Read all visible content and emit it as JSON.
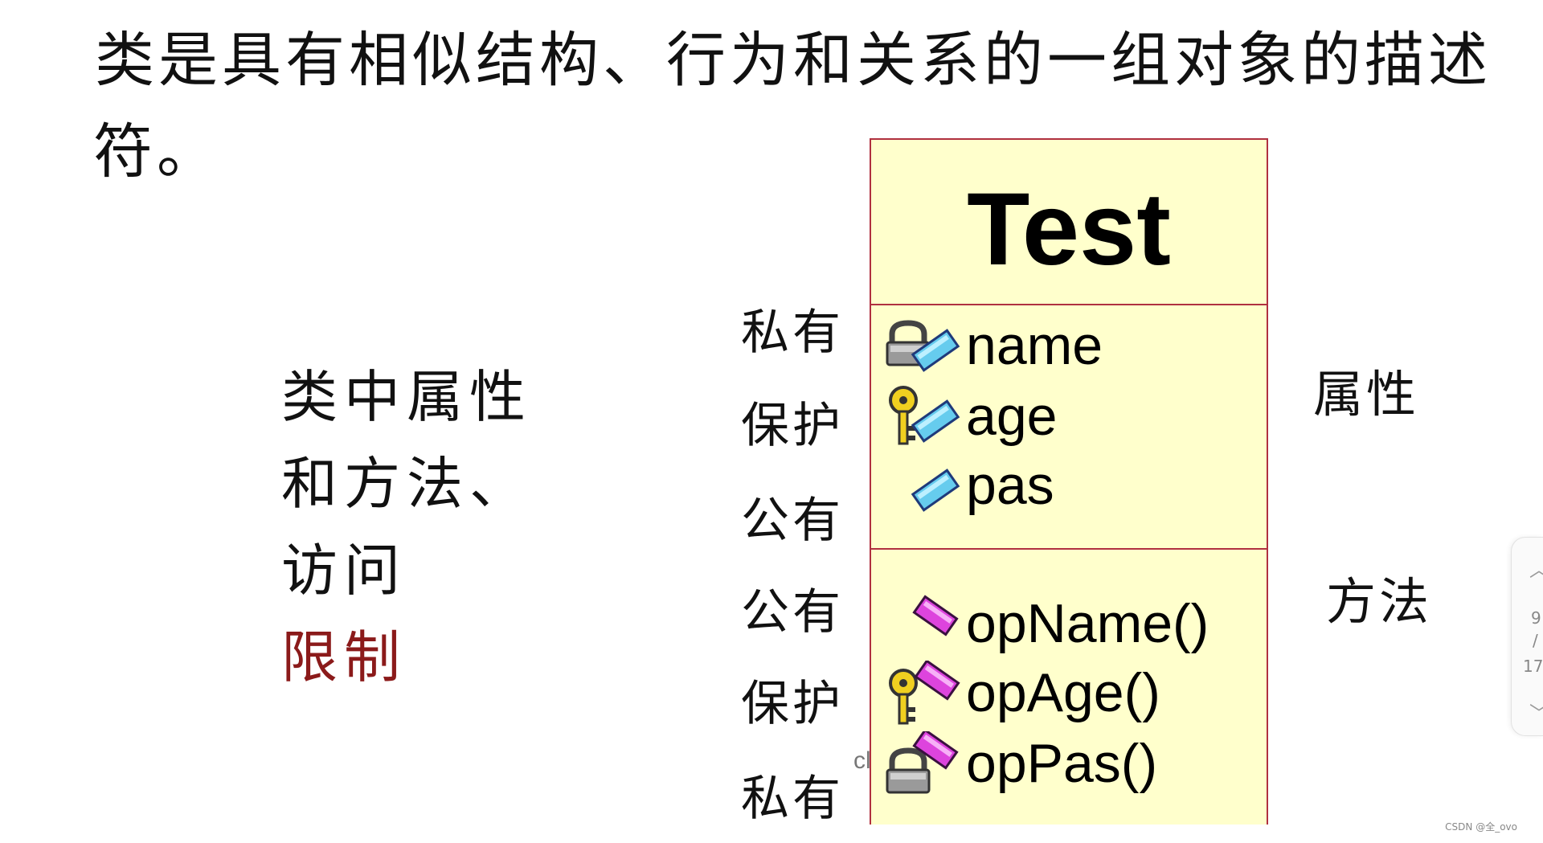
{
  "heading": {
    "line1": "类是具有相似结构、行为和关系的一组对象的描述",
    "line2": "符。"
  },
  "description": {
    "lines": [
      "类中属性",
      "和方法、",
      "访问"
    ],
    "highlight": "限制",
    "highlight_color": "#8b1a1a"
  },
  "access_labels": [
    "私有",
    "保护",
    "公有",
    "公有",
    "保护",
    "私有"
  ],
  "uml_class": {
    "name": "Test",
    "attributes": [
      {
        "name": "name",
        "visibility": "private",
        "icon": "lock-icon"
      },
      {
        "name": "age",
        "visibility": "protected",
        "icon": "key-icon"
      },
      {
        "name": "pas",
        "visibility": "public",
        "icon": "none"
      }
    ],
    "operations": [
      {
        "name": "opName()",
        "visibility": "public",
        "icon": "none"
      },
      {
        "name": "opAge()",
        "visibility": "protected",
        "icon": "key-icon"
      },
      {
        "name": "opPas()",
        "visibility": "private",
        "icon": "lock-icon"
      }
    ],
    "colors": {
      "fill": "#ffffcc",
      "border": "#b03040",
      "attribute_icon": "#66ccee",
      "operation_icon": "#dd44dd"
    }
  },
  "side_labels": {
    "attributes": "属性",
    "methods": "方法"
  },
  "fragment_text": "cl",
  "scroll": {
    "page_current": "9",
    "page_separator": "/",
    "page_total": "17",
    "up_icon": "chevron-up-icon",
    "down_icon": "chevron-down-icon"
  },
  "watermark": "CSDN @全_ovo"
}
